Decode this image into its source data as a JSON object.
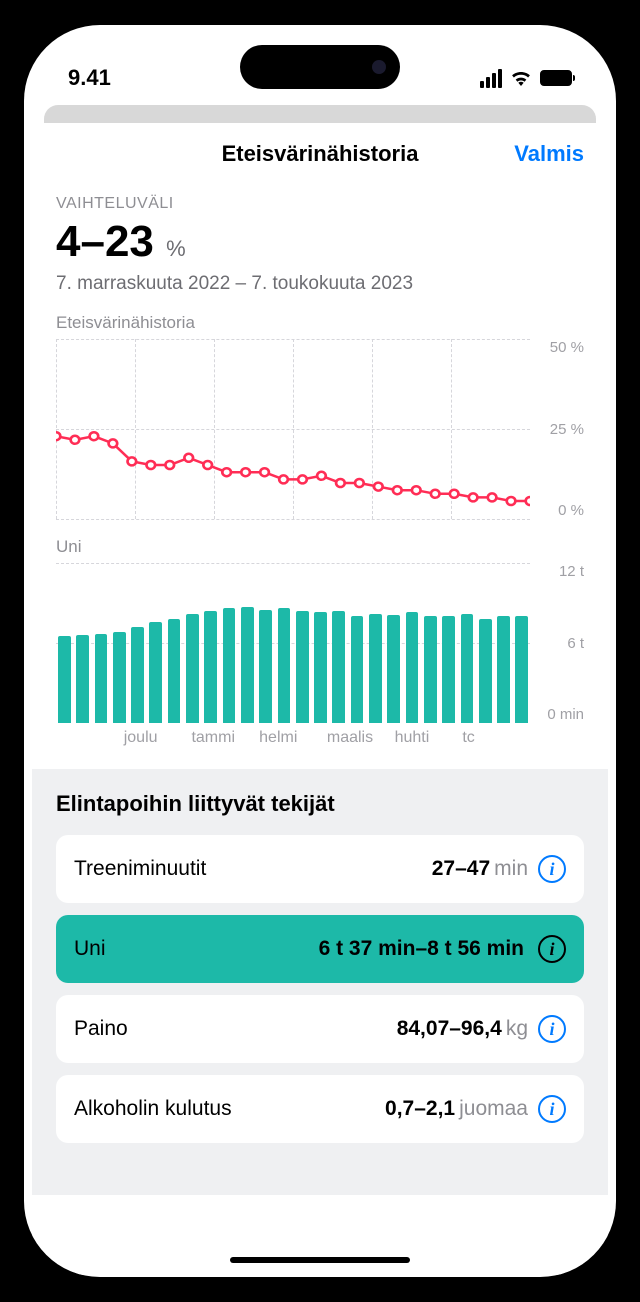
{
  "status_bar": {
    "time": "9.41"
  },
  "nav": {
    "title": "Eteisvärinähistoria",
    "done": "Valmis"
  },
  "range": {
    "label": "VAIHTELUVÄLI",
    "value": "4–23",
    "unit": "%",
    "date_range": "7. marraskuuta 2022 – 7. toukokuuta 2023"
  },
  "chart1": {
    "title": "Eteisvärinähistoria",
    "y_ticks": [
      "50 %",
      "25 %",
      "0 %"
    ]
  },
  "chart2": {
    "title": "Uni",
    "y_ticks": [
      "12 t",
      "6 t",
      "0 min"
    ]
  },
  "x_ticks": [
    "",
    "joulu",
    "tammi",
    "helmi",
    "maalis",
    "huhti",
    "tc"
  ],
  "lifestyle": {
    "title": "Elintapoihin liittyvät tekijät",
    "factors": [
      {
        "name": "Treeniminuutit",
        "value": "27–47",
        "unit": "min",
        "active": false
      },
      {
        "name": "Uni",
        "value": "6 t 37 min–8 t 56 min",
        "unit": "",
        "active": true
      },
      {
        "name": "Paino",
        "value": "84,07–96,4",
        "unit": "kg",
        "active": false
      },
      {
        "name": "Alkoholin kulutus",
        "value": "0,7–2,1",
        "unit": "juomaa",
        "active": false
      }
    ]
  },
  "chart_data": [
    {
      "type": "line",
      "title": "Eteisvärinähistoria",
      "ylabel": "%",
      "ylim": [
        0,
        50
      ],
      "x": [
        0,
        1,
        2,
        3,
        4,
        5,
        6,
        7,
        8,
        9,
        10,
        11,
        12,
        13,
        14,
        15,
        16,
        17,
        18,
        19,
        20,
        21,
        22,
        23,
        24,
        25
      ],
      "values": [
        23,
        22,
        23,
        21,
        16,
        15,
        15,
        17,
        15,
        13,
        13,
        13,
        11,
        11,
        12,
        10,
        10,
        9,
        8,
        8,
        7,
        7,
        6,
        6,
        5,
        5
      ]
    },
    {
      "type": "bar",
      "title": "Uni",
      "ylabel": "t",
      "ylim": [
        0,
        12
      ],
      "categories": [
        "",
        "joulu",
        "tammi",
        "helmi",
        "maalis",
        "huhti"
      ],
      "values": [
        6.5,
        6.6,
        6.7,
        6.8,
        7.2,
        7.6,
        7.8,
        8.2,
        8.4,
        8.6,
        8.7,
        8.5,
        8.6,
        8.4,
        8.3,
        8.4,
        8.0,
        8.2,
        8.1,
        8.3,
        8.0,
        8.0,
        8.2,
        7.8,
        8.0,
        8.0
      ]
    }
  ]
}
